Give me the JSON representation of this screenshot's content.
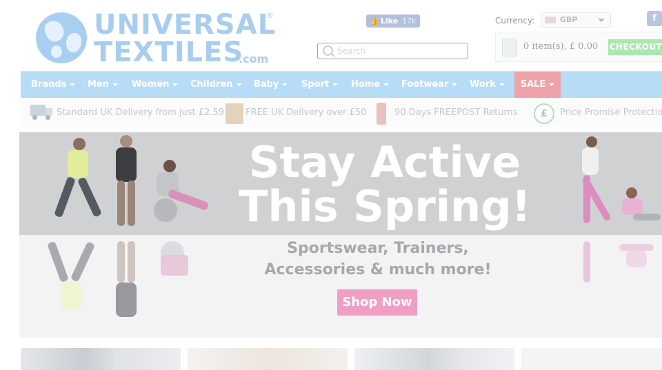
{
  "logo": {
    "line1": "UNIVERSAL",
    "reg": "®",
    "line2": "TEXTILES",
    "suffix": ".com"
  },
  "social": {
    "like_label": "Like",
    "like_count": "17k",
    "facebook_glyph": "f"
  },
  "search": {
    "placeholder": "Search"
  },
  "currency": {
    "label": "Currency:",
    "selected": "GBP"
  },
  "basket": {
    "summary": "0 item(s), £ 0.00",
    "checkout_label": "CHECKOUT"
  },
  "nav": {
    "items": [
      {
        "label": "Brands"
      },
      {
        "label": "Men"
      },
      {
        "label": "Women"
      },
      {
        "label": "Children"
      },
      {
        "label": "Baby"
      },
      {
        "label": "Sport"
      },
      {
        "label": "Home"
      },
      {
        "label": "Footwear"
      },
      {
        "label": "Work"
      },
      {
        "label": "SALE"
      }
    ]
  },
  "usp": {
    "delivery": "Standard UK Delivery from just £2.59",
    "free_delivery": "FREE UK Delivery over £50",
    "returns": "90 Days FREEPOST Returns",
    "price_promise": "Price Promise Protection",
    "pound_glyph": "£"
  },
  "banner": {
    "headline_1": "Stay Active",
    "headline_2": "This Spring!",
    "subline_1": "Sportswear, Trainers,",
    "subline_2": "Accessories & much more!",
    "cta": "Shop Now"
  },
  "colors": {
    "logo_blue": "#a8cdee",
    "nav_bg": "#b7dcf5",
    "sale_bg": "#eda3a8",
    "checkout_bg": "#a9e8b0",
    "cta_bg": "#ef9fc4"
  }
}
